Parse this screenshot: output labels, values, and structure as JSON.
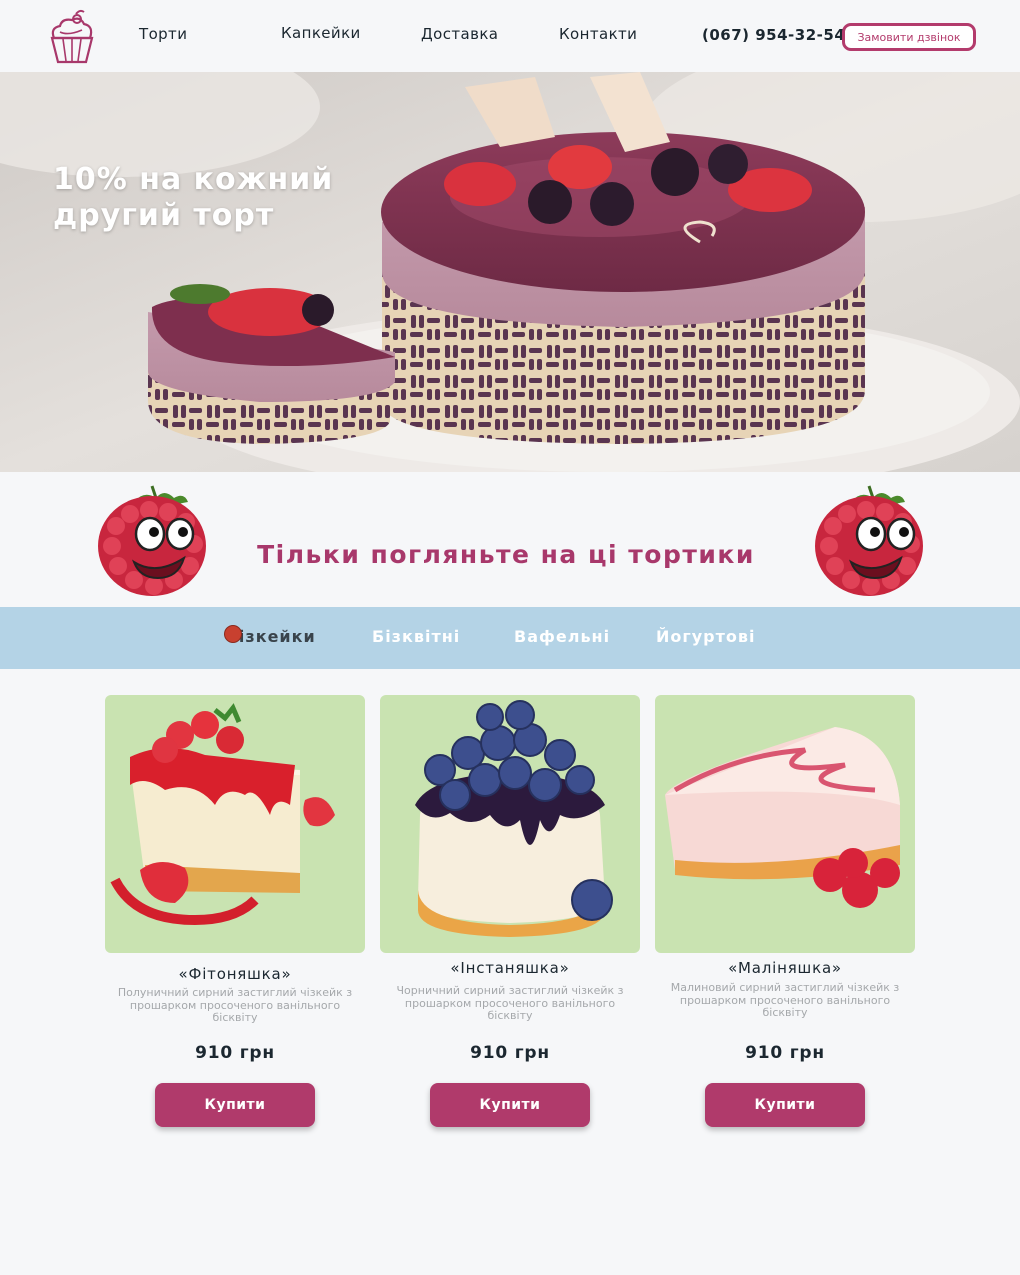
{
  "header": {
    "nav": [
      {
        "label": "Торти"
      },
      {
        "label": "Капкейки"
      },
      {
        "label": "Доставка"
      },
      {
        "label": "Контакти"
      }
    ],
    "phone": "(067) 954-32-54",
    "callback_label": "Замовити дзвінок",
    "logo_icon": "cupcake-icon"
  },
  "hero": {
    "title": "10% на кожний другий торт"
  },
  "section": {
    "title": "Тільки погляньте на ці тортики",
    "mascot_icon": "raspberry-mascot-icon"
  },
  "tabs": [
    {
      "label": "Чізкейки",
      "active": true
    },
    {
      "label": "Бізквітні",
      "active": false
    },
    {
      "label": "Вафельні",
      "active": false
    },
    {
      "label": "Йогуртові",
      "active": false
    }
  ],
  "products": [
    {
      "name": "«Фітоняшка»",
      "desc": "Полуничний сирний застиглий чізкейк з прошарком просоченого ванільного бісквіту",
      "price": "910 грн",
      "buy_label": "Купити"
    },
    {
      "name": "«Інстаняшка»",
      "desc": "Чорничний сирний застиглий чізкейк з прошарком просоченого ванільного бісквіту",
      "price": "910 грн",
      "buy_label": "Купити"
    },
    {
      "name": "«Маліняшка»",
      "desc": "Малиновий сирний застиглий чізкейк з прошарком просоченого ванільного бісквіту",
      "price": "910 грн",
      "buy_label": "Купити"
    }
  ],
  "colors": {
    "accent": "#b03a6b",
    "tabs_bg": "#b4d3e6",
    "card_bg": "#c9e3b1",
    "page_bg": "#f6f7f9"
  }
}
